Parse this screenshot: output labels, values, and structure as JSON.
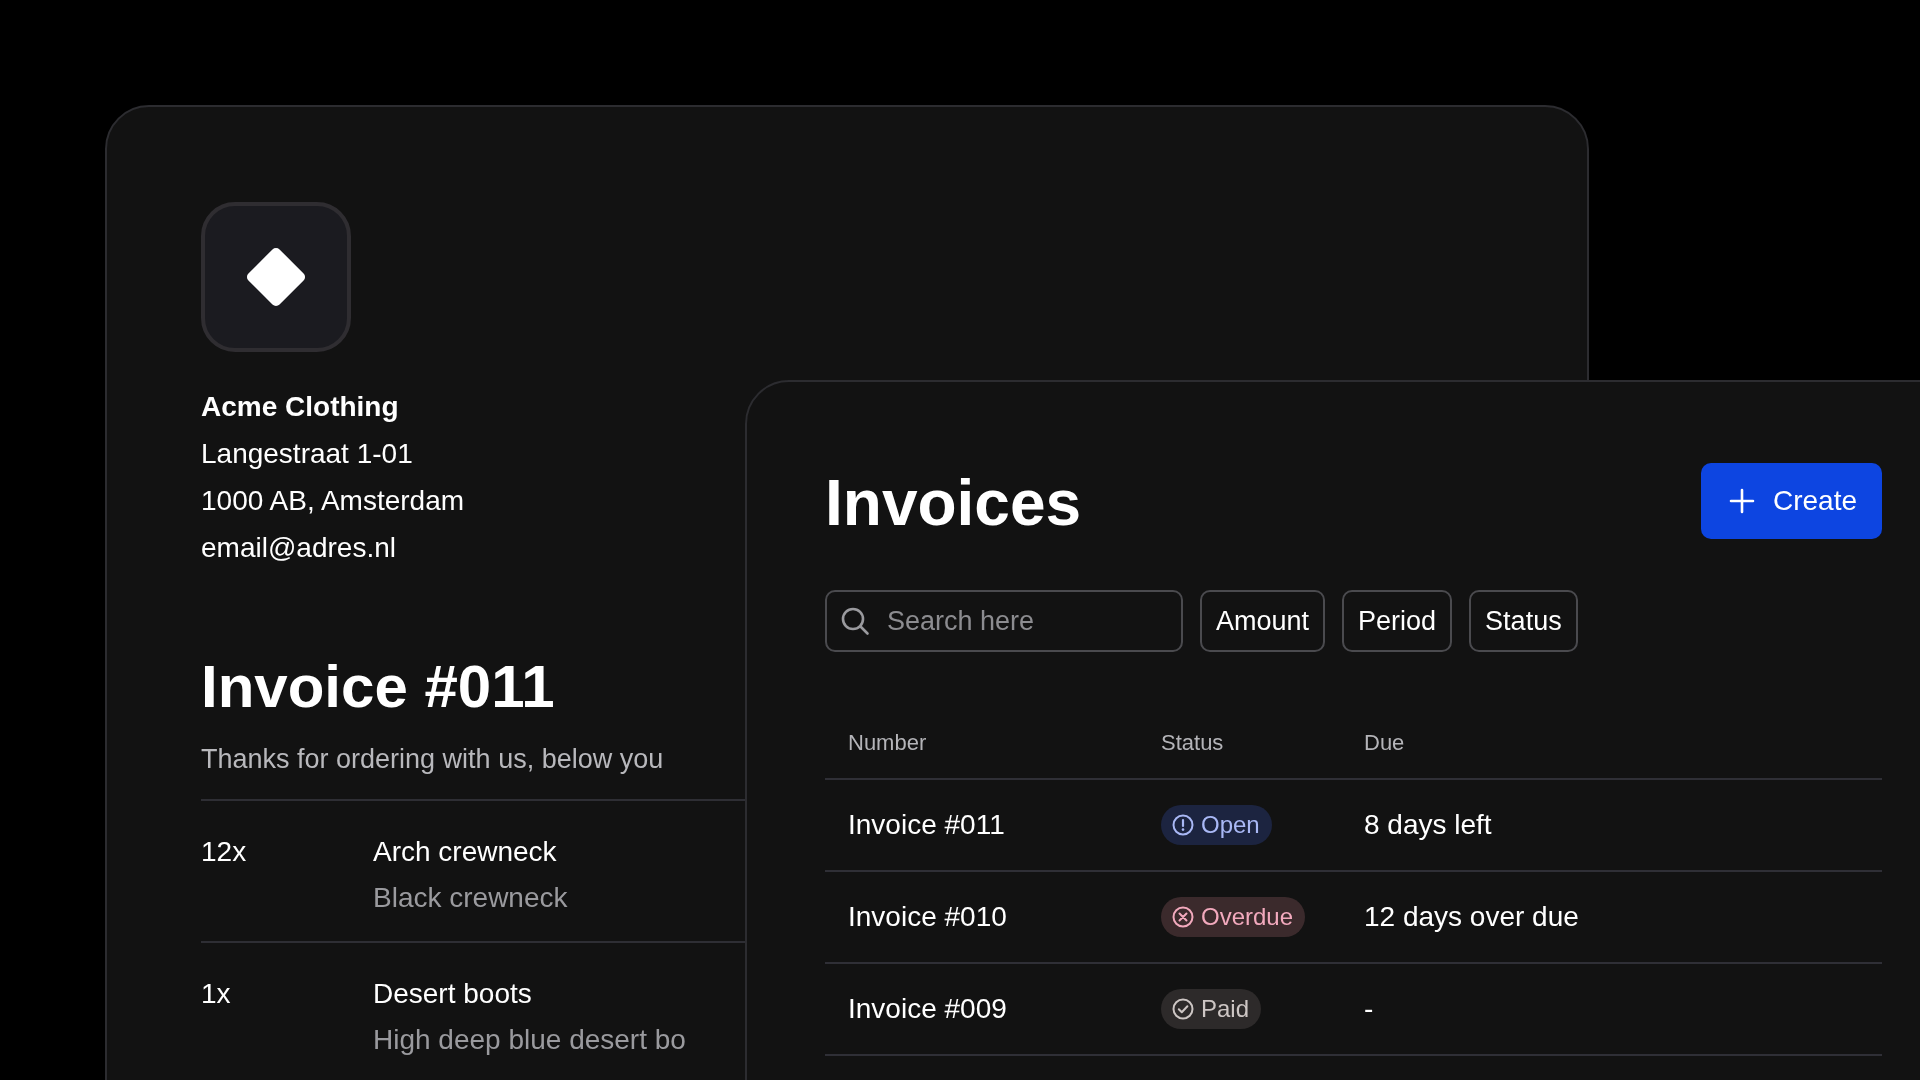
{
  "invoice_card": {
    "company": {
      "name": "Acme Clothing",
      "address_lines": [
        "Langestraat 1-01",
        "1000 AB, Amsterdam",
        "email@adres.nl"
      ]
    },
    "title": "Invoice #011",
    "intro": "Thanks for ordering with us, below you",
    "items": [
      {
        "quantity": "12x",
        "name": "Arch crewneck",
        "description": "Black crewneck"
      },
      {
        "quantity": "1x",
        "name": "Desert boots",
        "description": "High deep blue desert bo"
      }
    ]
  },
  "invoices_panel": {
    "title": "Invoices",
    "create_button": "Create",
    "search": {
      "placeholder": "Search here"
    },
    "filters": [
      "Amount",
      "Period",
      "Status"
    ],
    "table": {
      "columns": [
        "Number",
        "Status",
        "Due"
      ],
      "rows": [
        {
          "number": "Invoice #011",
          "status": {
            "kind": "open",
            "label": "Open"
          },
          "due": "8 days left"
        },
        {
          "number": "Invoice #010",
          "status": {
            "kind": "overdue",
            "label": "Overdue"
          },
          "due": "12 days over due"
        },
        {
          "number": "Invoice #009",
          "status": {
            "kind": "paid",
            "label": "Paid"
          },
          "due": "-"
        }
      ]
    }
  }
}
